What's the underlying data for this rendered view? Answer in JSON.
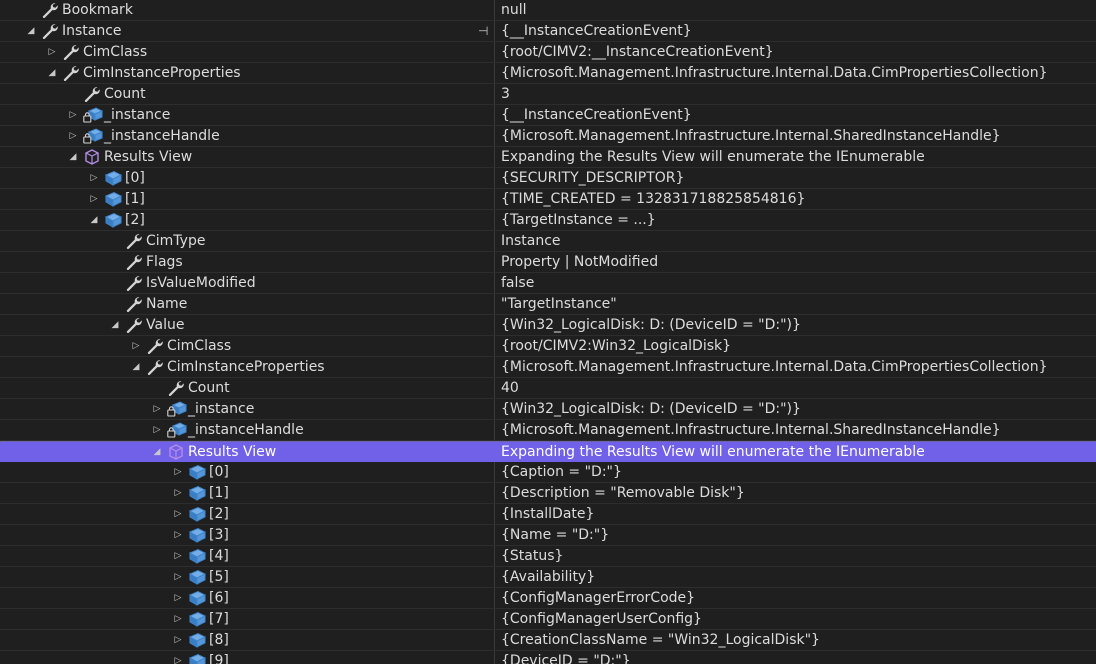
{
  "colors": {
    "background": "#1f1f1f",
    "selection": "#7160e8",
    "text": "#dcdcdc"
  },
  "rows": [
    {
      "depth": 0,
      "expander": "none",
      "icon": "wrench-icon",
      "name": "Bookmark",
      "value": "null"
    },
    {
      "depth": 0,
      "expander": "expanded",
      "icon": "wrench-icon",
      "name": "Instance",
      "value": "{__InstanceCreationEvent}",
      "pin": true
    },
    {
      "depth": 1,
      "expander": "collapsed",
      "icon": "wrench-icon",
      "name": "CimClass",
      "value": "{root/CIMV2:__InstanceCreationEvent}"
    },
    {
      "depth": 1,
      "expander": "expanded",
      "icon": "wrench-icon",
      "name": "CimInstanceProperties",
      "value": "{Microsoft.Management.Infrastructure.Internal.Data.CimPropertiesCollection}"
    },
    {
      "depth": 2,
      "expander": "none",
      "icon": "wrench-icon",
      "name": "Count",
      "value": "3"
    },
    {
      "depth": 2,
      "expander": "collapsed",
      "icon": "locked-object-icon",
      "name": "_instance",
      "value": "{__InstanceCreationEvent}"
    },
    {
      "depth": 2,
      "expander": "collapsed",
      "icon": "locked-object-icon",
      "name": "_instanceHandle",
      "value": "{Microsoft.Management.Infrastructure.Internal.SharedInstanceHandle}"
    },
    {
      "depth": 2,
      "expander": "expanded",
      "icon": "cube-icon",
      "name": "Results View",
      "value": "Expanding the Results View will enumerate the IEnumerable"
    },
    {
      "depth": 3,
      "expander": "collapsed",
      "icon": "object-icon",
      "name": "[0]",
      "value": "{SECURITY_DESCRIPTOR}"
    },
    {
      "depth": 3,
      "expander": "collapsed",
      "icon": "object-icon",
      "name": "[1]",
      "value": "{TIME_CREATED = 132831718825854816}"
    },
    {
      "depth": 3,
      "expander": "expanded",
      "icon": "object-icon",
      "name": "[2]",
      "value": "{TargetInstance = ...}"
    },
    {
      "depth": 4,
      "expander": "none",
      "icon": "wrench-icon",
      "name": "CimType",
      "value": "Instance"
    },
    {
      "depth": 4,
      "expander": "none",
      "icon": "wrench-icon",
      "name": "Flags",
      "value": "Property | NotModified"
    },
    {
      "depth": 4,
      "expander": "none",
      "icon": "wrench-icon",
      "name": "IsValueModified",
      "value": "false"
    },
    {
      "depth": 4,
      "expander": "none",
      "icon": "wrench-icon",
      "name": "Name",
      "value": "\"TargetInstance\""
    },
    {
      "depth": 4,
      "expander": "expanded",
      "icon": "wrench-icon",
      "name": "Value",
      "value": "{Win32_LogicalDisk: D: (DeviceID = \"D:\")}"
    },
    {
      "depth": 5,
      "expander": "collapsed",
      "icon": "wrench-icon",
      "name": "CimClass",
      "value": "{root/CIMV2:Win32_LogicalDisk}"
    },
    {
      "depth": 5,
      "expander": "expanded",
      "icon": "wrench-icon",
      "name": "CimInstanceProperties",
      "value": "{Microsoft.Management.Infrastructure.Internal.Data.CimPropertiesCollection}"
    },
    {
      "depth": 6,
      "expander": "none",
      "icon": "wrench-icon",
      "name": "Count",
      "value": "40"
    },
    {
      "depth": 6,
      "expander": "collapsed",
      "icon": "locked-object-icon",
      "name": "_instance",
      "value": "{Win32_LogicalDisk: D: (DeviceID = \"D:\")}"
    },
    {
      "depth": 6,
      "expander": "collapsed",
      "icon": "locked-object-icon",
      "name": "_instanceHandle",
      "value": "{Microsoft.Management.Infrastructure.Internal.SharedInstanceHandle}"
    },
    {
      "depth": 6,
      "expander": "expanded",
      "icon": "cube-icon",
      "name": "Results View",
      "value": "Expanding the Results View will enumerate the IEnumerable",
      "selected": true
    },
    {
      "depth": 7,
      "expander": "collapsed",
      "icon": "object-icon",
      "name": "[0]",
      "value": "{Caption = \"D:\"}"
    },
    {
      "depth": 7,
      "expander": "collapsed",
      "icon": "object-icon",
      "name": "[1]",
      "value": "{Description = \"Removable Disk\"}"
    },
    {
      "depth": 7,
      "expander": "collapsed",
      "icon": "object-icon",
      "name": "[2]",
      "value": "{InstallDate}"
    },
    {
      "depth": 7,
      "expander": "collapsed",
      "icon": "object-icon",
      "name": "[3]",
      "value": "{Name = \"D:\"}"
    },
    {
      "depth": 7,
      "expander": "collapsed",
      "icon": "object-icon",
      "name": "[4]",
      "value": "{Status}"
    },
    {
      "depth": 7,
      "expander": "collapsed",
      "icon": "object-icon",
      "name": "[5]",
      "value": "{Availability}"
    },
    {
      "depth": 7,
      "expander": "collapsed",
      "icon": "object-icon",
      "name": "[6]",
      "value": "{ConfigManagerErrorCode}"
    },
    {
      "depth": 7,
      "expander": "collapsed",
      "icon": "object-icon",
      "name": "[7]",
      "value": "{ConfigManagerUserConfig}"
    },
    {
      "depth": 7,
      "expander": "collapsed",
      "icon": "object-icon",
      "name": "[8]",
      "value": "{CreationClassName = \"Win32_LogicalDisk\"}"
    },
    {
      "depth": 7,
      "expander": "collapsed",
      "icon": "object-icon",
      "name": "[9]",
      "value": "{DeviceID = \"D:\"}"
    }
  ]
}
